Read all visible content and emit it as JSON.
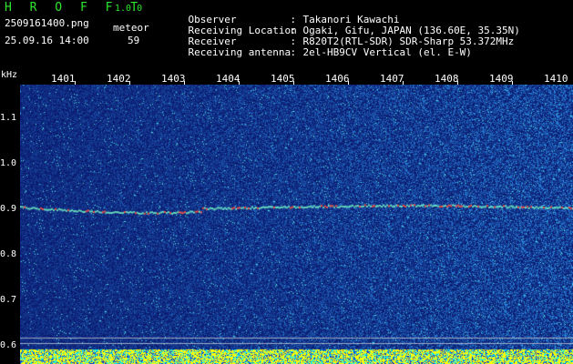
{
  "header": {
    "app_name": "H R O F F T",
    "version": "1.0.0",
    "filename": "2509161400.png",
    "datetime": "25.09.16 14:00",
    "meteor_label": "meteor",
    "meteor_count": "59",
    "info": [
      {
        "label": "Observer",
        "value": "Takanori Kawachi"
      },
      {
        "label": "Receiving Location",
        "value": "Ogaki, Gifu, JAPAN (136.60E, 35.35N)"
      },
      {
        "label": "Receiver",
        "value": "R820T2(RTL-SDR) SDR-Sharp 53.372MHz"
      },
      {
        "label": "Receiving antenna",
        "value": "2el-HB9CV Vertical (el. E-W)"
      }
    ],
    "separator": ":"
  },
  "time_axis": {
    "labels": [
      "1401",
      "1402",
      "1403",
      "1404",
      "1405",
      "1406",
      "1407",
      "1408",
      "1409",
      "1410"
    ]
  },
  "freq_axis": {
    "unit": "kHz",
    "labels": [
      "1.1",
      "1.0",
      "0.9",
      "0.8",
      "0.7",
      "0.6"
    ]
  },
  "colors": {
    "background": "#000000",
    "title_green": "#2ee62e",
    "spectrum_low": "#0a1a8c",
    "spectrum_high": "#ff2a2a",
    "bottom_strip_yellow": "#ffff00",
    "bottom_strip_cyan": "#00ffff"
  }
}
